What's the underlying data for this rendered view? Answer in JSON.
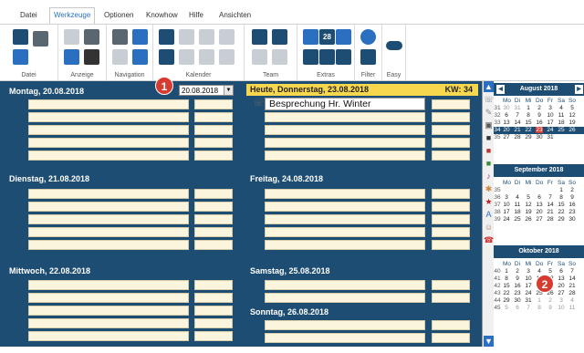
{
  "menu": [
    "Datei",
    "Werkzeuge",
    "Optionen",
    "Knowhow",
    "Hilfe",
    "Ansichten"
  ],
  "ribbon": {
    "groups": [
      "Datei",
      "Anzeige",
      "Navigation",
      "Kalender",
      "Team",
      "Extras",
      "Filter",
      "Easy"
    ],
    "calendar_day_icon_number": "28"
  },
  "toolbar": {
    "date_value": "20.08.2018"
  },
  "today_bar": {
    "label": "Heute, Donnerstag, 23.08.2018",
    "kw": "KW: 34"
  },
  "days": [
    {
      "label": "Montag, 20.08.2018"
    },
    {
      "label": "Dienstag, 21.08.2018"
    },
    {
      "label": "Mittwoch, 22.08.2018"
    },
    {
      "label": "Freitag, 24.08.2018"
    },
    {
      "label": "Samstag, 25.08.2018"
    },
    {
      "label": "Sonntag, 26.08.2018"
    }
  ],
  "appointment": {
    "title": "Besprechung Hr. Winter"
  },
  "badges": [
    "1",
    "2"
  ],
  "weekday_header": [
    "Mo",
    "Di",
    "Mi",
    "Do",
    "Fr",
    "Sa",
    "So"
  ],
  "calendars": [
    {
      "month": "August 2018",
      "weeks": [
        {
          "kw": "31",
          "days": [
            "30",
            "31",
            "1",
            "2",
            "3",
            "4",
            "5"
          ]
        },
        {
          "kw": "32",
          "days": [
            "6",
            "7",
            "8",
            "9",
            "10",
            "11",
            "12"
          ]
        },
        {
          "kw": "33",
          "days": [
            "13",
            "14",
            "15",
            "16",
            "17",
            "18",
            "19"
          ]
        },
        {
          "kw": "34",
          "days": [
            "20",
            "21",
            "22",
            "23",
            "24",
            "25",
            "26"
          ]
        },
        {
          "kw": "35",
          "days": [
            "27",
            "28",
            "29",
            "30",
            "31",
            "",
            ""
          ]
        }
      ]
    },
    {
      "month": "September 2018",
      "weeks": [
        {
          "kw": "35",
          "days": [
            "",
            "",
            "",
            "",
            "",
            "1",
            "2"
          ]
        },
        {
          "kw": "36",
          "days": [
            "3",
            "4",
            "5",
            "6",
            "7",
            "8",
            "9"
          ]
        },
        {
          "kw": "37",
          "days": [
            "10",
            "11",
            "12",
            "13",
            "14",
            "15",
            "16"
          ]
        },
        {
          "kw": "38",
          "days": [
            "17",
            "18",
            "19",
            "20",
            "21",
            "22",
            "23"
          ]
        },
        {
          "kw": "39",
          "days": [
            "24",
            "25",
            "26",
            "27",
            "28",
            "29",
            "30"
          ]
        }
      ]
    },
    {
      "month": "Oktober 2018",
      "weeks": [
        {
          "kw": "40",
          "days": [
            "1",
            "2",
            "3",
            "4",
            "5",
            "6",
            "7"
          ]
        },
        {
          "kw": "41",
          "days": [
            "8",
            "9",
            "10",
            "11",
            "12",
            "13",
            "14"
          ]
        },
        {
          "kw": "42",
          "days": [
            "15",
            "16",
            "17",
            "18",
            "19",
            "20",
            "21"
          ]
        },
        {
          "kw": "43",
          "days": [
            "22",
            "23",
            "24",
            "25",
            "26",
            "27",
            "28"
          ]
        },
        {
          "kw": "44",
          "days": [
            "29",
            "30",
            "31",
            "1",
            "2",
            "3",
            "4"
          ]
        },
        {
          "kw": "45",
          "days": [
            "5",
            "6",
            "7",
            "8",
            "9",
            "10",
            "11"
          ]
        }
      ]
    }
  ]
}
